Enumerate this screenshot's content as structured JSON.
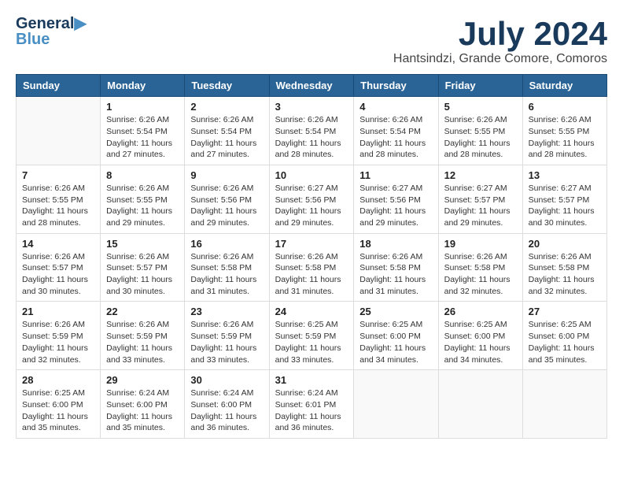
{
  "header": {
    "logo_line1": "General",
    "logo_line2": "Blue",
    "month_title": "July 2024",
    "location": "Hantsindzi, Grande Comore, Comoros"
  },
  "weekdays": [
    "Sunday",
    "Monday",
    "Tuesday",
    "Wednesday",
    "Thursday",
    "Friday",
    "Saturday"
  ],
  "weeks": [
    [
      {
        "day": "",
        "info": ""
      },
      {
        "day": "1",
        "info": "Sunrise: 6:26 AM\nSunset: 5:54 PM\nDaylight: 11 hours\nand 27 minutes."
      },
      {
        "day": "2",
        "info": "Sunrise: 6:26 AM\nSunset: 5:54 PM\nDaylight: 11 hours\nand 27 minutes."
      },
      {
        "day": "3",
        "info": "Sunrise: 6:26 AM\nSunset: 5:54 PM\nDaylight: 11 hours\nand 28 minutes."
      },
      {
        "day": "4",
        "info": "Sunrise: 6:26 AM\nSunset: 5:54 PM\nDaylight: 11 hours\nand 28 minutes."
      },
      {
        "day": "5",
        "info": "Sunrise: 6:26 AM\nSunset: 5:55 PM\nDaylight: 11 hours\nand 28 minutes."
      },
      {
        "day": "6",
        "info": "Sunrise: 6:26 AM\nSunset: 5:55 PM\nDaylight: 11 hours\nand 28 minutes."
      }
    ],
    [
      {
        "day": "7",
        "info": "Sunrise: 6:26 AM\nSunset: 5:55 PM\nDaylight: 11 hours\nand 28 minutes."
      },
      {
        "day": "8",
        "info": "Sunrise: 6:26 AM\nSunset: 5:55 PM\nDaylight: 11 hours\nand 29 minutes."
      },
      {
        "day": "9",
        "info": "Sunrise: 6:26 AM\nSunset: 5:56 PM\nDaylight: 11 hours\nand 29 minutes."
      },
      {
        "day": "10",
        "info": "Sunrise: 6:27 AM\nSunset: 5:56 PM\nDaylight: 11 hours\nand 29 minutes."
      },
      {
        "day": "11",
        "info": "Sunrise: 6:27 AM\nSunset: 5:56 PM\nDaylight: 11 hours\nand 29 minutes."
      },
      {
        "day": "12",
        "info": "Sunrise: 6:27 AM\nSunset: 5:57 PM\nDaylight: 11 hours\nand 29 minutes."
      },
      {
        "day": "13",
        "info": "Sunrise: 6:27 AM\nSunset: 5:57 PM\nDaylight: 11 hours\nand 30 minutes."
      }
    ],
    [
      {
        "day": "14",
        "info": "Sunrise: 6:26 AM\nSunset: 5:57 PM\nDaylight: 11 hours\nand 30 minutes."
      },
      {
        "day": "15",
        "info": "Sunrise: 6:26 AM\nSunset: 5:57 PM\nDaylight: 11 hours\nand 30 minutes."
      },
      {
        "day": "16",
        "info": "Sunrise: 6:26 AM\nSunset: 5:58 PM\nDaylight: 11 hours\nand 31 minutes."
      },
      {
        "day": "17",
        "info": "Sunrise: 6:26 AM\nSunset: 5:58 PM\nDaylight: 11 hours\nand 31 minutes."
      },
      {
        "day": "18",
        "info": "Sunrise: 6:26 AM\nSunset: 5:58 PM\nDaylight: 11 hours\nand 31 minutes."
      },
      {
        "day": "19",
        "info": "Sunrise: 6:26 AM\nSunset: 5:58 PM\nDaylight: 11 hours\nand 32 minutes."
      },
      {
        "day": "20",
        "info": "Sunrise: 6:26 AM\nSunset: 5:58 PM\nDaylight: 11 hours\nand 32 minutes."
      }
    ],
    [
      {
        "day": "21",
        "info": "Sunrise: 6:26 AM\nSunset: 5:59 PM\nDaylight: 11 hours\nand 32 minutes."
      },
      {
        "day": "22",
        "info": "Sunrise: 6:26 AM\nSunset: 5:59 PM\nDaylight: 11 hours\nand 33 minutes."
      },
      {
        "day": "23",
        "info": "Sunrise: 6:26 AM\nSunset: 5:59 PM\nDaylight: 11 hours\nand 33 minutes."
      },
      {
        "day": "24",
        "info": "Sunrise: 6:25 AM\nSunset: 5:59 PM\nDaylight: 11 hours\nand 33 minutes."
      },
      {
        "day": "25",
        "info": "Sunrise: 6:25 AM\nSunset: 6:00 PM\nDaylight: 11 hours\nand 34 minutes."
      },
      {
        "day": "26",
        "info": "Sunrise: 6:25 AM\nSunset: 6:00 PM\nDaylight: 11 hours\nand 34 minutes."
      },
      {
        "day": "27",
        "info": "Sunrise: 6:25 AM\nSunset: 6:00 PM\nDaylight: 11 hours\nand 35 minutes."
      }
    ],
    [
      {
        "day": "28",
        "info": "Sunrise: 6:25 AM\nSunset: 6:00 PM\nDaylight: 11 hours\nand 35 minutes."
      },
      {
        "day": "29",
        "info": "Sunrise: 6:24 AM\nSunset: 6:00 PM\nDaylight: 11 hours\nand 35 minutes."
      },
      {
        "day": "30",
        "info": "Sunrise: 6:24 AM\nSunset: 6:00 PM\nDaylight: 11 hours\nand 36 minutes."
      },
      {
        "day": "31",
        "info": "Sunrise: 6:24 AM\nSunset: 6:01 PM\nDaylight: 11 hours\nand 36 minutes."
      },
      {
        "day": "",
        "info": ""
      },
      {
        "day": "",
        "info": ""
      },
      {
        "day": "",
        "info": ""
      }
    ]
  ]
}
